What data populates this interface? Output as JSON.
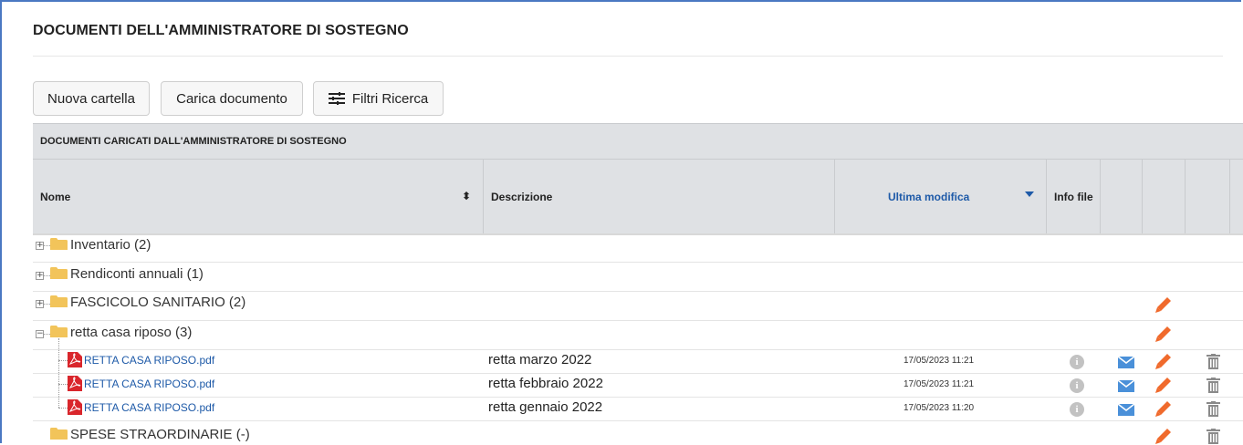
{
  "page": {
    "title": "DOCUMENTI DELL'AMMINISTRATORE DI SOSTEGNO"
  },
  "toolbar": {
    "new_folder_label": "Nuova cartella",
    "upload_label": "Carica documento",
    "filters_label": "Filtri Ricerca"
  },
  "section": {
    "title": "DOCUMENTI CARICATI DALL'AMMINISTRATORE DI SOSTEGNO"
  },
  "table": {
    "headers": {
      "nome": "Nome",
      "descrizione": "Descrizione",
      "ultima_modifica": "Ultima modifica",
      "info_file": "Info file"
    },
    "sorted_column": "Ultima modifica",
    "folders": [
      {
        "name": "Inventario (2)",
        "expanded": false
      },
      {
        "name": "Rendiconti annuali (1)",
        "expanded": false
      },
      {
        "name": "FASCICOLO SANITARIO (2)",
        "expanded": false
      },
      {
        "name": "retta casa riposo (3)",
        "expanded": true
      },
      {
        "name": "SPESE STRAORDINARIE (-)",
        "expanded": false
      }
    ],
    "files": [
      {
        "name": "RETTA CASA RIPOSO.pdf",
        "description": "retta marzo 2022",
        "modified": "17/05/2023 11:21"
      },
      {
        "name": "RETTA CASA RIPOSO.pdf",
        "description": "retta febbraio 2022",
        "modified": "17/05/2023 11:21"
      },
      {
        "name": "RETTA CASA RIPOSO.pdf",
        "description": "retta gennaio 2022",
        "modified": "17/05/2023 11:20"
      }
    ]
  },
  "icons": {
    "folder": "folder-icon",
    "pdf": "pdf-file-icon",
    "info": "info-icon",
    "mail": "mail-icon",
    "edit": "pencil-icon",
    "delete": "trash-icon"
  },
  "colors": {
    "accent_blue": "#1e5aa8",
    "edit_orange": "#f06a2c",
    "mail_blue": "#4a90d9",
    "folder_yellow": "#f2c45a",
    "pdf_red": "#d9262c",
    "header_gray": "#dfe1e4"
  }
}
